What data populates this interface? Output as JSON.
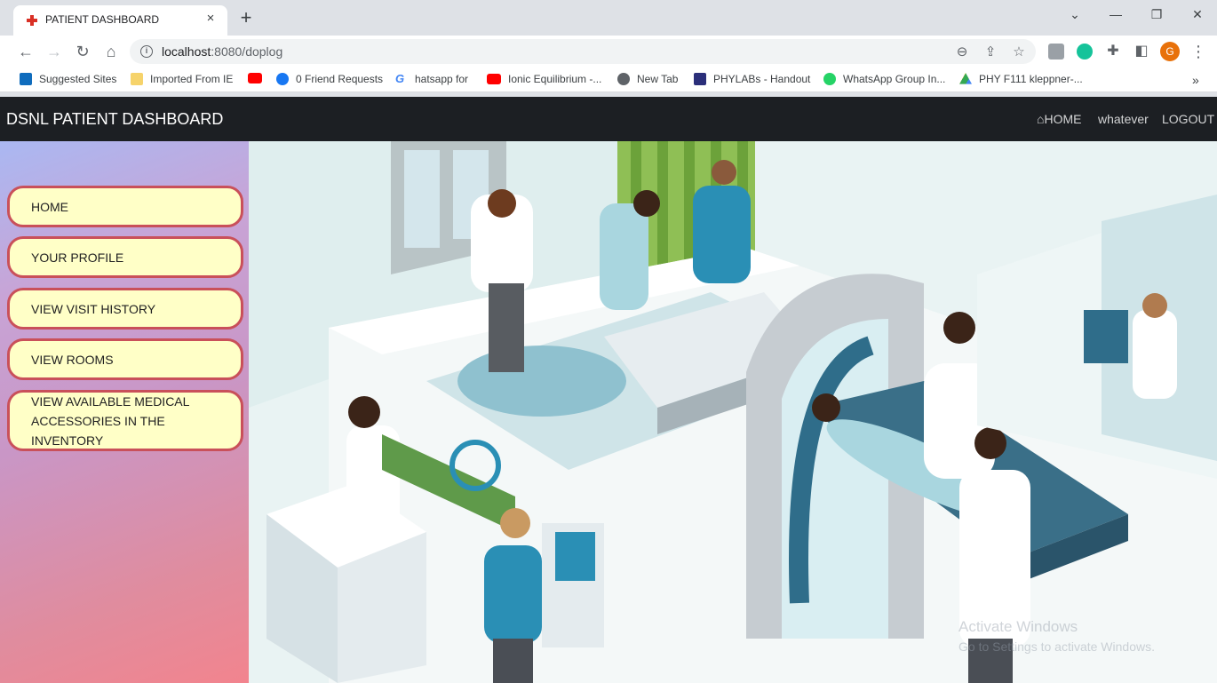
{
  "browser": {
    "tab_title": "PATIENT DASHBOARD",
    "tab_close": "×",
    "new_tab": "+",
    "url_host": "localhost",
    "url_path": ":8080/doplog",
    "avatar_letter": "G"
  },
  "bookmarks": [
    {
      "label": "Suggested Sites",
      "icon": "bing-icon",
      "color": "#0f6cbd"
    },
    {
      "label": "Imported From IE",
      "icon": "folder-icon",
      "color": "#f6d36b"
    },
    {
      "label": "",
      "icon": "youtube-icon",
      "color": "#ff0000"
    },
    {
      "label": "0 Friend Requests",
      "icon": "facebook-icon",
      "color": "#1877f2"
    },
    {
      "label": "hatsapp for",
      "icon": "google-icon",
      "color": "#4285f4"
    },
    {
      "label": "Ionic Equilibrium -...",
      "icon": "youtube-icon",
      "color": "#ff0000"
    },
    {
      "label": "New Tab",
      "icon": "globe-icon",
      "color": "#5f6368"
    },
    {
      "label": "PHYLABs - Handout",
      "icon": "bits-logo-icon",
      "color": "#2b2f7a"
    },
    {
      "label": "WhatsApp Group In...",
      "icon": "whatsapp-icon",
      "color": "#25d366"
    },
    {
      "label": "PHY F111 kleppner-...",
      "icon": "google-drive-icon",
      "color": "#fbbc04"
    }
  ],
  "bookmarks_overflow": "»",
  "app": {
    "brand": "DSNL PATIENT DASHBOARD",
    "nav_home": "HOME",
    "nav_user": "whatever",
    "nav_logout": "LOGOUT"
  },
  "sidebar": [
    {
      "label": "HOME"
    },
    {
      "label": "YOUR PROFILE"
    },
    {
      "label": "VIEW VISIT HISTORY"
    },
    {
      "label": "VIEW ROOMS"
    },
    {
      "label": "VIEW AVAILABLE MEDICAL ACCESSORIES IN THE INVENTORY"
    }
  ],
  "watermark": {
    "line1": "Activate Windows",
    "line2": "Go to Settings to activate Windows."
  },
  "colors": {
    "navbar": "#1c1f23",
    "sidebar_button_bg": "#ffffc7",
    "sidebar_button_border": "#c9505a"
  }
}
